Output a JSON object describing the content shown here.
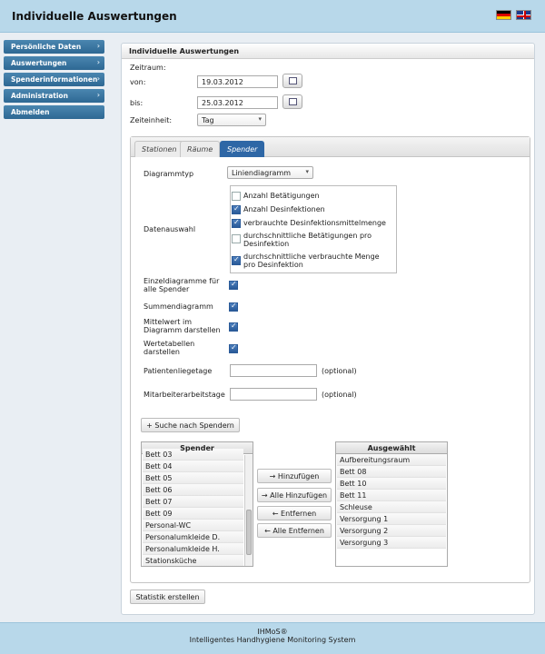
{
  "header": {
    "title": "Individuelle Auswertungen"
  },
  "nav": [
    {
      "label": "Persönliche Daten"
    },
    {
      "label": "Auswertungen"
    },
    {
      "label": "Spenderinformationen"
    },
    {
      "label": "Administration"
    },
    {
      "label": "Abmelden"
    }
  ],
  "panel": {
    "title": "Individuelle Auswertungen",
    "zeitraum_label": "Zeitraum:",
    "von_label": "von:",
    "von_value": "19.03.2012",
    "bis_label": "bis:",
    "bis_value": "25.03.2012",
    "zeiteinheit_label": "Zeiteinheit:",
    "zeiteinheit_value": "Tag"
  },
  "tabs": [
    {
      "label": "Stationen"
    },
    {
      "label": "Räume"
    },
    {
      "label": "Spender",
      "active": true
    }
  ],
  "form": {
    "diagrammtyp_label": "Diagrammtyp",
    "diagrammtyp_value": "Liniendiagramm",
    "datenauswahl_label": "Datenauswahl",
    "datenauswahl": [
      {
        "label": "Anzahl Betätigungen",
        "checked": false
      },
      {
        "label": "Anzahl Desinfektionen",
        "checked": true
      },
      {
        "label": "verbrauchte Desinfektionsmittelmenge",
        "checked": true
      },
      {
        "label": "durchschnittliche Betätigungen pro Desinfektion",
        "checked": false
      },
      {
        "label": "durchschnittliche verbrauchte Menge pro Desinfektion",
        "checked": true
      }
    ],
    "einzeldiagramme_label": "Einzeldiagramme für alle Spender",
    "summendiagramm_label": "Summendiagramm",
    "mittelwert_label": "Mittelwert im Diagramm darstellen",
    "wertetabellen_label": "Wertetabellen darstellen",
    "patientenliegetage_label": "Patientenliegetage",
    "mitarbeiterarbeitstage_label": "Mitarbeiterarbeitstage",
    "optional": "(optional)",
    "suche_button": "Suche nach Spendern"
  },
  "spender": {
    "header": "Spender",
    "items": [
      "Bett 03",
      "Bett 04",
      "Bett 05",
      "Bett 06",
      "Bett 07",
      "Bett 09",
      "Personal-WC",
      "Personalumkleide D.",
      "Personalumkleide H.",
      "Stationsküche"
    ]
  },
  "ausgewaehlt": {
    "header": "Ausgewählt",
    "items": [
      "Aufbereitungsraum",
      "Bett 08",
      "Bett 10",
      "Bett 11",
      "Schleuse",
      "Versorgung 1",
      "Versorgung 2",
      "Versorgung 3"
    ]
  },
  "buttons": {
    "hinzufuegen": "Hinzufügen",
    "alle_hinzufuegen": "Alle Hinzufügen",
    "entfernen": "Entfernen",
    "alle_entfernen": "Alle Entfernen",
    "statistik": "Statistik erstellen"
  },
  "footer": {
    "line1": "IHMoS®",
    "line2": "Intelligentes Handhygiene Monitoring System"
  }
}
